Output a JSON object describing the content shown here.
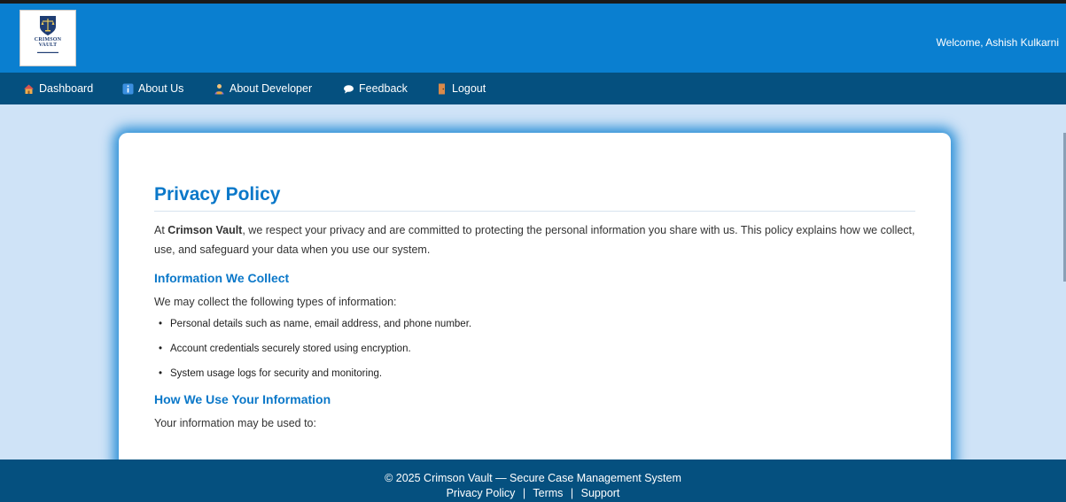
{
  "header": {
    "logo_text": "CRIMSON",
    "logo_sub": "VAULT",
    "welcome": "Welcome, Ashish Kulkarni"
  },
  "nav": {
    "items": [
      {
        "label": "Dashboard",
        "icon": "house-icon"
      },
      {
        "label": "About Us",
        "icon": "info-icon"
      },
      {
        "label": "About Developer",
        "icon": "developer-icon"
      },
      {
        "label": "Feedback",
        "icon": "speech-bubble-icon"
      },
      {
        "label": "Logout",
        "icon": "door-icon"
      }
    ]
  },
  "page": {
    "title": "Privacy Policy",
    "intro_prefix": "At ",
    "intro_brand": "Crimson Vault",
    "intro_rest": ", we respect your privacy and are committed to protecting the personal information you share with us. This policy explains how we collect, use, and safeguard your data when you use our system.",
    "section1_title": "Information We Collect",
    "section1_text": "We may collect the following types of information:",
    "section1_items": [
      "Personal details such as name, email address, and phone number.",
      "Account credentials securely stored using encryption.",
      "System usage logs for security and monitoring."
    ],
    "section2_title": "How We Use Your Information",
    "section2_text": "Your information may be used to:"
  },
  "footer": {
    "copyright": "© 2025 Crimson Vault — Secure Case Management System",
    "links": [
      "Privacy Policy",
      "Terms",
      "Support"
    ],
    "separator": "|"
  },
  "colors": {
    "header": "#0a7fd0",
    "nav": "#05507f",
    "accent": "#0b78c9",
    "background": "#cfe3f7"
  }
}
